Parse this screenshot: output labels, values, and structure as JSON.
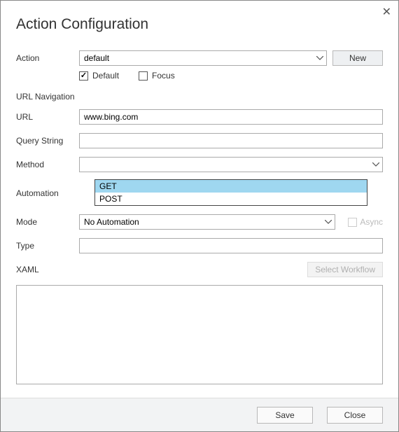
{
  "dialog": {
    "title": "Action Configuration"
  },
  "labels": {
    "action": "Action",
    "url_navigation": "URL Navigation",
    "url": "URL",
    "query_string": "Query String",
    "method": "Method",
    "automation": "Automation",
    "mode": "Mode",
    "type": "Type",
    "xaml": "XAML"
  },
  "action": {
    "selected": "default",
    "new_button": "New",
    "default_cb_label": "Default",
    "default_cb_checked": true,
    "focus_cb_label": "Focus",
    "focus_cb_checked": false
  },
  "url": {
    "value": "www.bing.com"
  },
  "query_string": {
    "value": ""
  },
  "method": {
    "selected": "",
    "options": [
      "GET",
      "POST"
    ],
    "highlighted": "GET"
  },
  "mode": {
    "selected": "No Automation",
    "async_label": "Async",
    "async_checked": false
  },
  "type": {
    "value": ""
  },
  "xaml": {
    "select_workflow_button": "Select Workflow",
    "content": ""
  },
  "footer": {
    "save": "Save",
    "close": "Close"
  }
}
